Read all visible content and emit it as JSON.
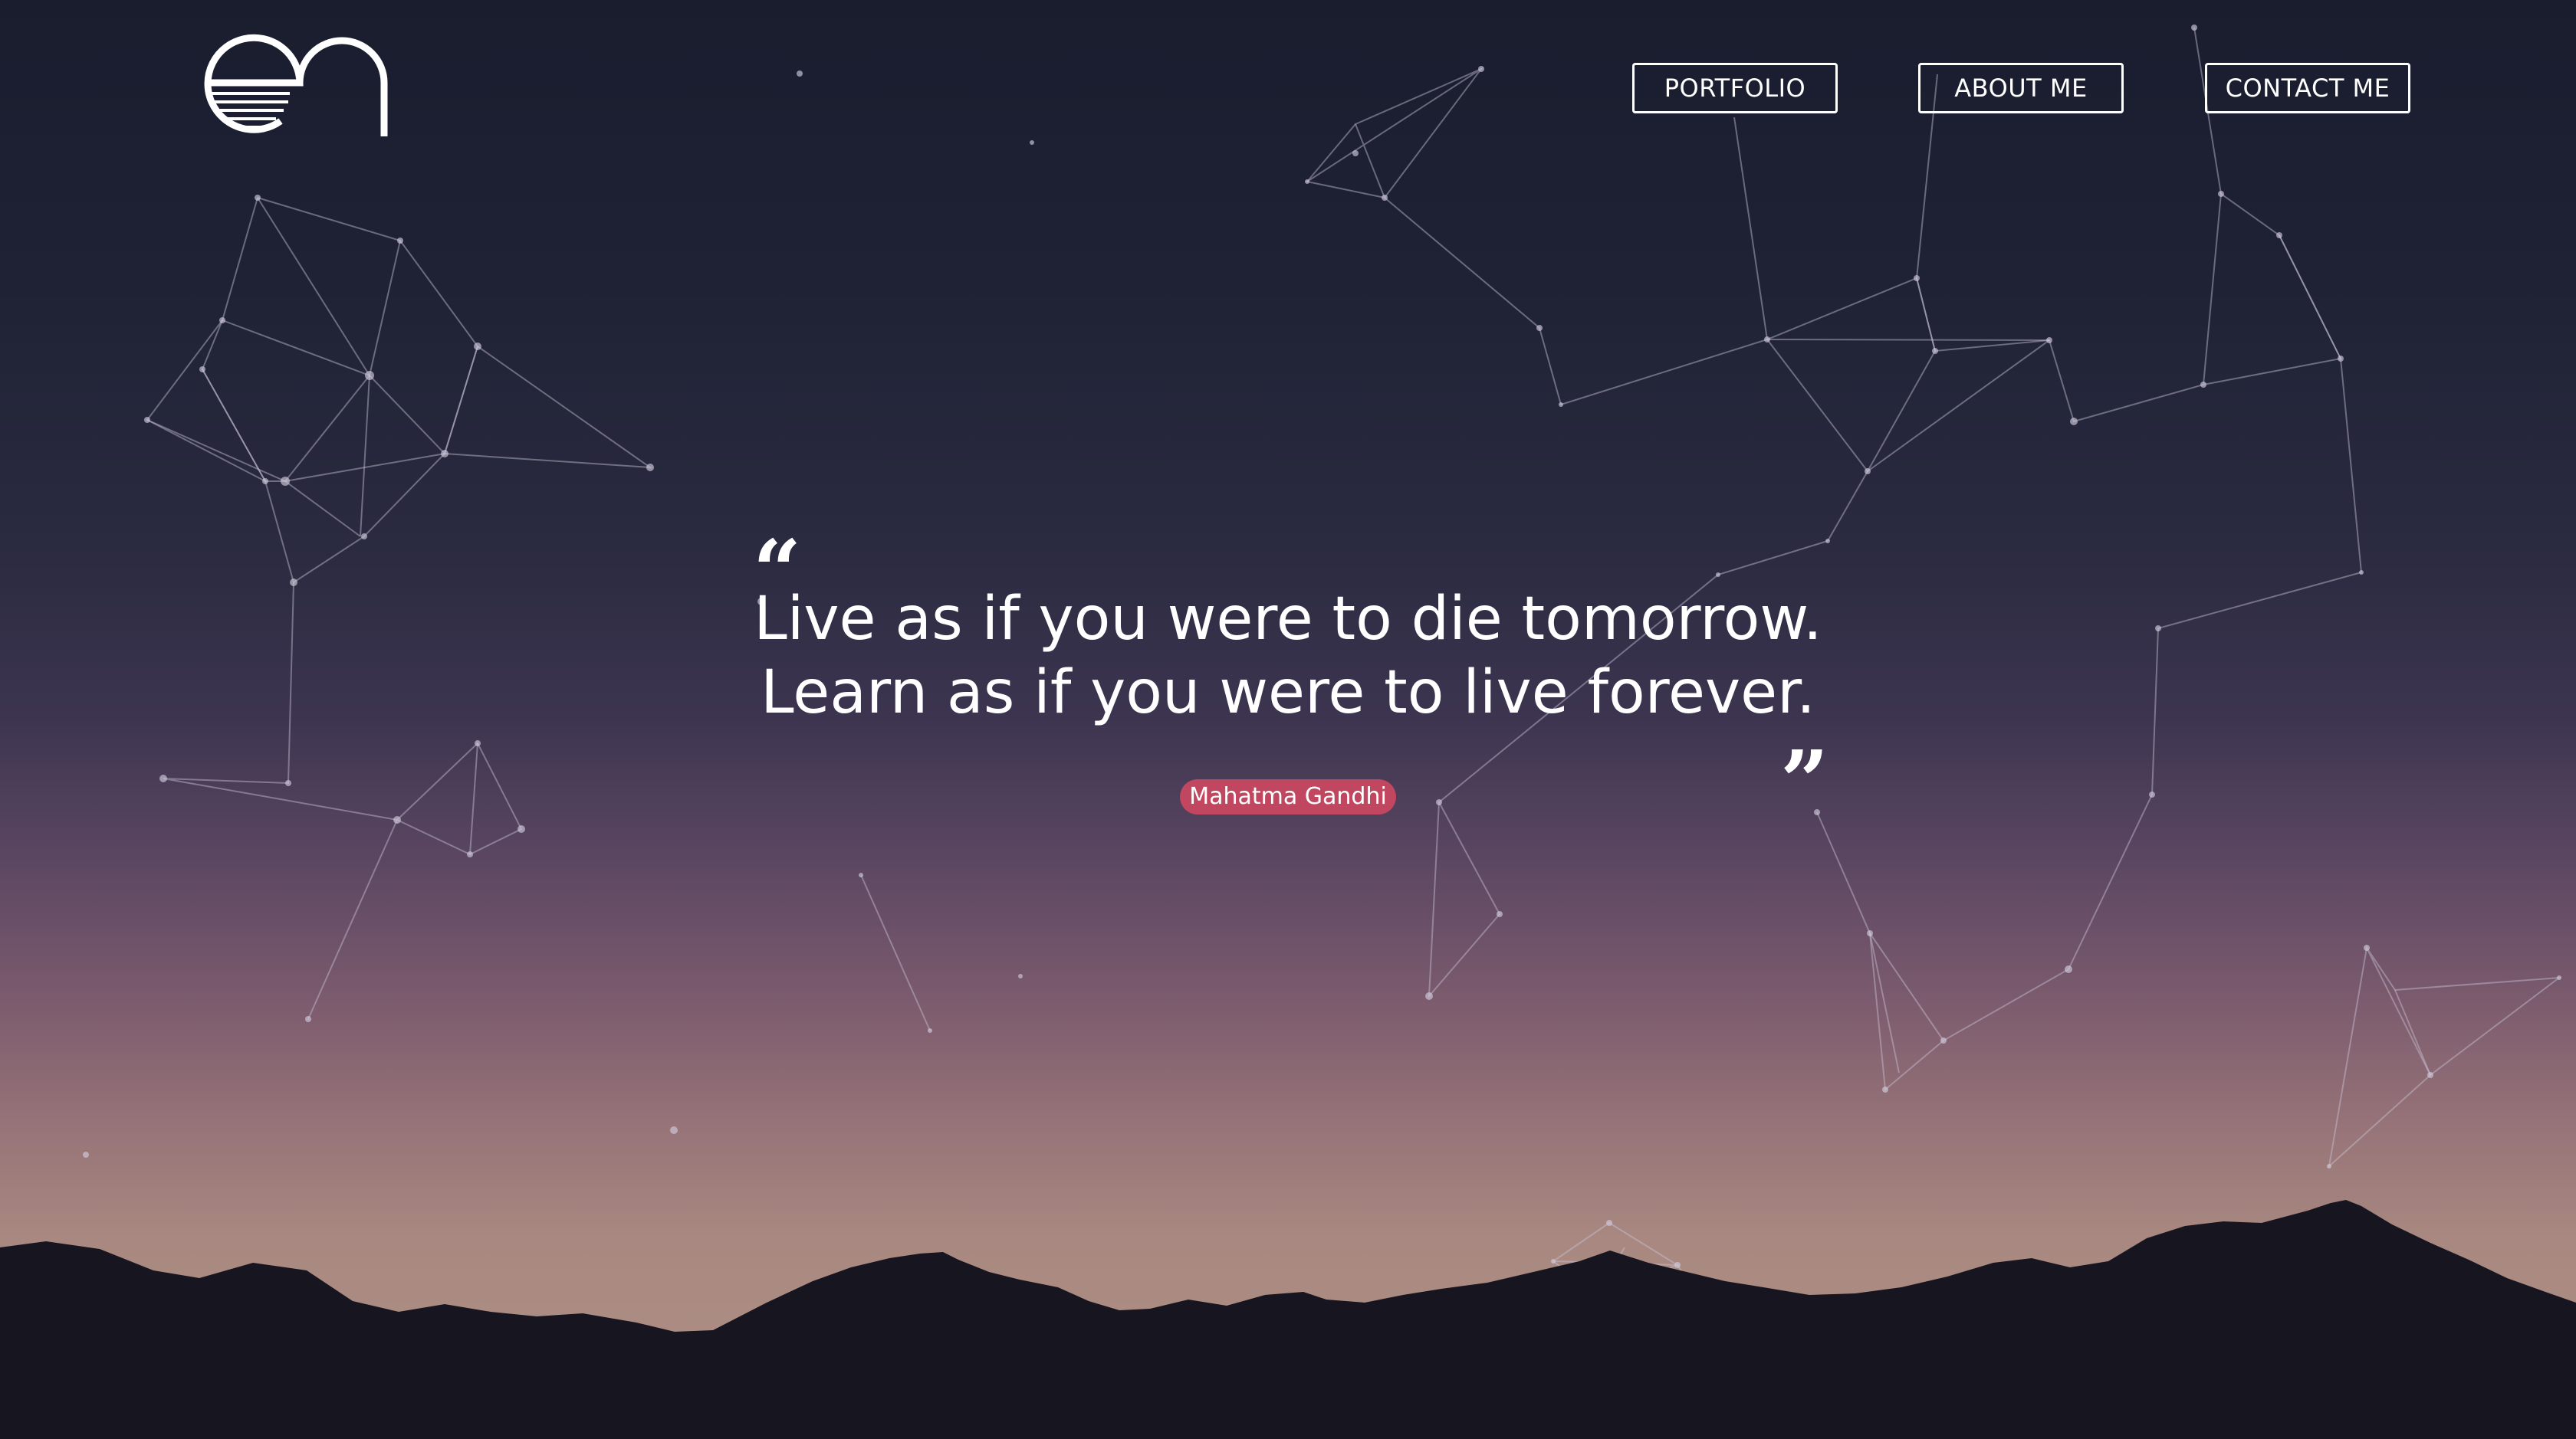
{
  "logo": {
    "name": "logo-icon"
  },
  "nav": {
    "items": [
      {
        "label": "PORTFOLIO"
      },
      {
        "label": "ABOUT ME"
      },
      {
        "label": "CONTACT ME"
      }
    ]
  },
  "hero": {
    "open_quote": "“",
    "close_quote": "”",
    "quote_lines": [
      "Live as if you were to die tomorrow.",
      "Learn as if you were to live forever."
    ],
    "author": "Mahatma Gandhi"
  },
  "colors": {
    "accent": "#c0475f",
    "text": "#ffffff",
    "sky_top": "#191d2e",
    "sky_bottom": "#b09285",
    "mountains": "#17151f"
  }
}
